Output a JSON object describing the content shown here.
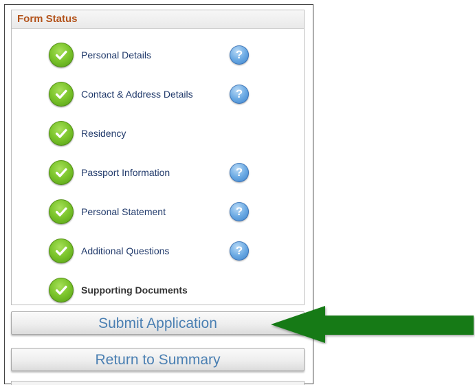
{
  "panel": {
    "title": "Form Status",
    "steps": [
      {
        "label": "Personal Details",
        "status": "complete",
        "help": true
      },
      {
        "label": "Contact & Address Details",
        "status": "complete",
        "help": true
      },
      {
        "label": "Residency",
        "status": "complete",
        "help": false
      },
      {
        "label": "Passport Information",
        "status": "complete",
        "help": true
      },
      {
        "label": "Personal Statement",
        "status": "complete",
        "help": true
      },
      {
        "label": "Additional Questions",
        "status": "complete",
        "help": true
      },
      {
        "label": "Supporting Documents",
        "status": "complete",
        "help": false
      }
    ],
    "help_glyph": "?"
  },
  "buttons": {
    "submit_label": "Submit Application",
    "return_label": "Return to Summary"
  },
  "annotation": {
    "arrow_color": "#137a13",
    "arrow_icon": "arrow-left-icon"
  },
  "colors": {
    "header_text": "#b3531b",
    "step_text": "#213a6b",
    "button_text": "#4a7fb2",
    "check_green": "#7cc52c",
    "help_blue": "#6aa9e3"
  }
}
